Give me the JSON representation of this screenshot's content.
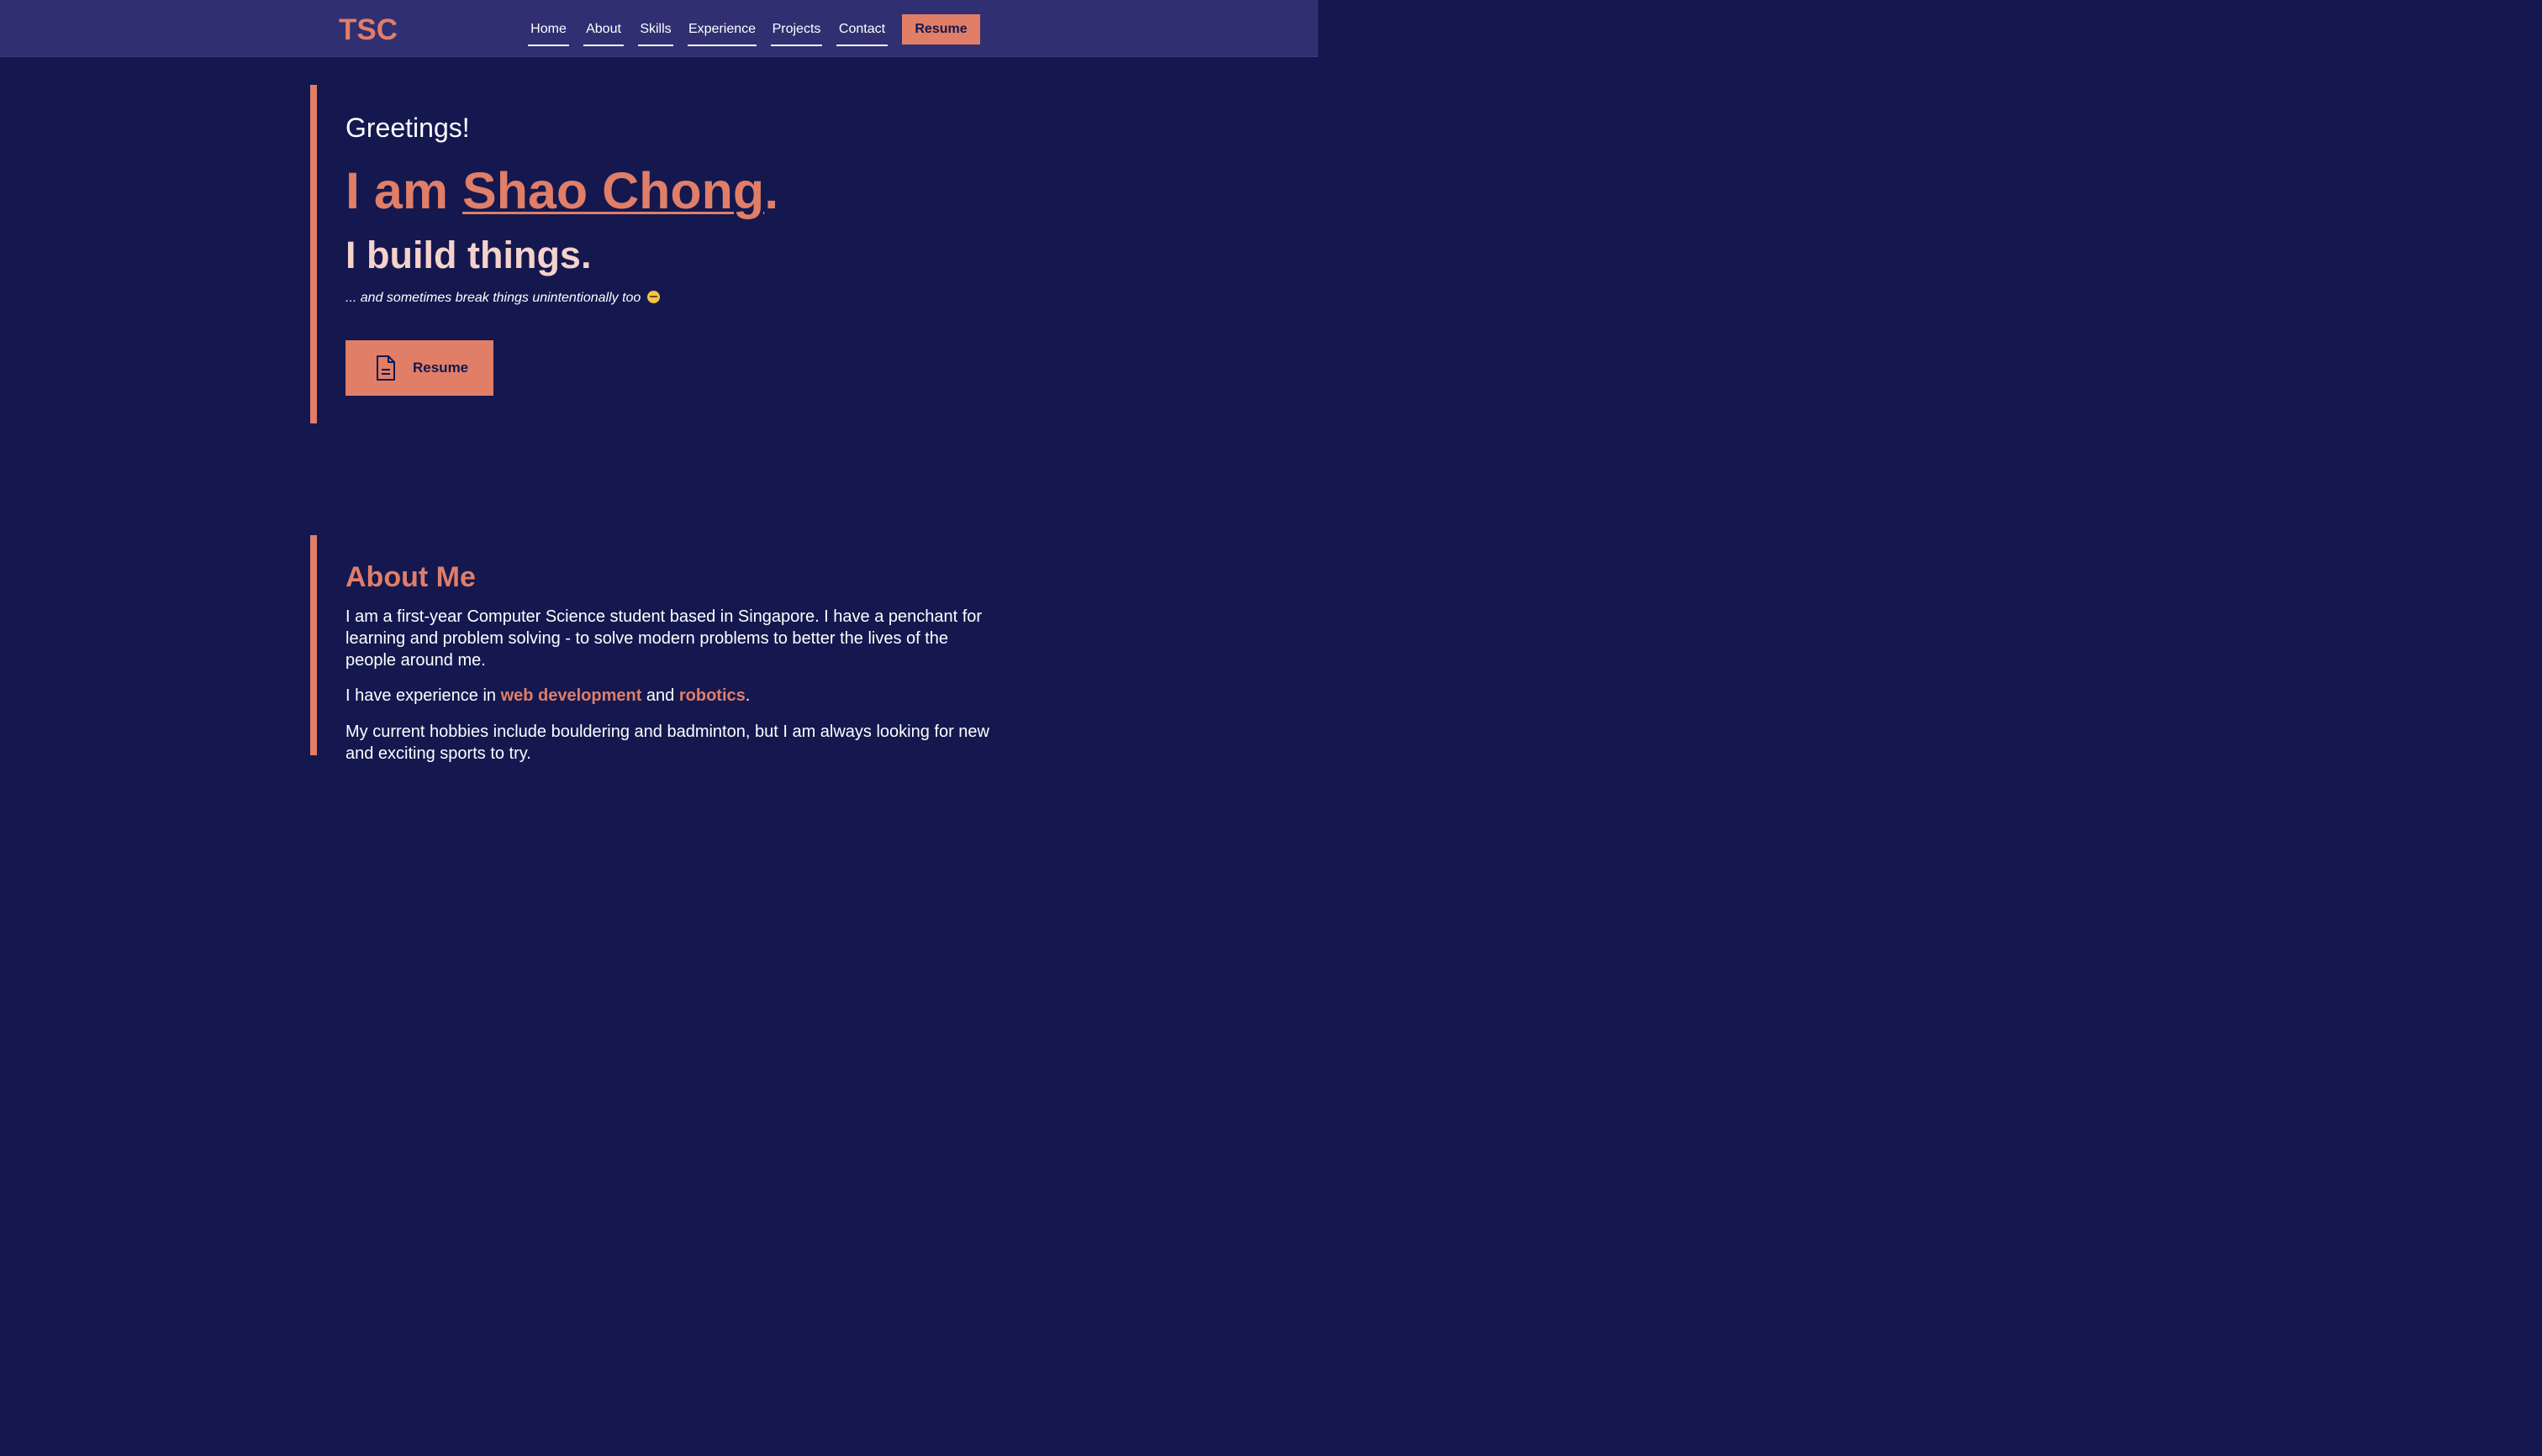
{
  "nav": {
    "logo": "TSC",
    "links": [
      "Home",
      "About",
      "Skills",
      "Experience",
      "Projects",
      "Contact"
    ],
    "resume_label": "Resume"
  },
  "hero": {
    "greeting": "Greetings!",
    "headline_prefix": "I am ",
    "name": "Shao Chong",
    "headline_suffix": ".",
    "tagline": "I build things.",
    "subtext": "... and sometimes break things unintentionally too",
    "resume_label": "Resume",
    "resume_icon": "document-icon"
  },
  "about": {
    "title": "About Me",
    "paragraph1": "I am a first-year Computer Science student based in Singapore. I have a penchant for learning and problem solving - to solve modern problems to better the lives of the people around me.",
    "paragraph2_prefix": "I have experience in ",
    "highlight1": "web development",
    "paragraph2_middle": " and ",
    "highlight2": "robotics",
    "paragraph2_suffix": ".",
    "paragraph3": "My current hobbies include bouldering and badminton, but I am always looking for new and exciting sports to try."
  },
  "colors": {
    "background": "#14184f",
    "navbar": "#2f2f72",
    "accent": "#e07e68",
    "tagline": "#f5d2cb"
  }
}
